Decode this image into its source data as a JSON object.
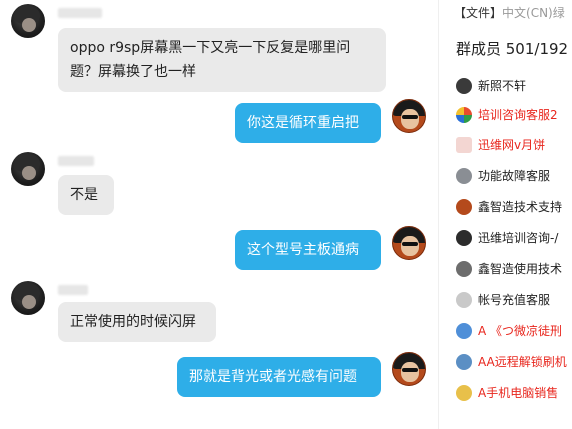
{
  "chat": {
    "messages": [
      {
        "side": "in",
        "text_line1": "oppo  r9sp屏幕黑一下又亮一下反复是哪里问",
        "text_line2": "题？屏幕换了也一样"
      },
      {
        "side": "out",
        "text": "你这是循环重启把"
      },
      {
        "side": "in",
        "text": "不是"
      },
      {
        "side": "out",
        "text": "这个型号主板通病"
      },
      {
        "side": "in",
        "text": "正常使用的时候闪屏"
      },
      {
        "side": "out",
        "text": "那就是背光或者光感有问题"
      }
    ]
  },
  "sidebar": {
    "file_tab": "【文件】",
    "file_sub": "中文(CN)绿",
    "members_title": "群成员 501/192",
    "members": [
      {
        "name": "新照不轩",
        "color": "#222222",
        "icon": "avatar-icon-dark"
      },
      {
        "name": "培训咨询客服2",
        "color": "#e8261d",
        "icon": "avatar-icon-colorful"
      },
      {
        "name": "迅维网v月饼",
        "color": "#e8261d",
        "icon": "avatar-icon-red"
      },
      {
        "name": "功能故障客服",
        "color": "#222222",
        "icon": "avatar-icon-gray"
      },
      {
        "name": "鑫智造技术支持",
        "color": "#222222",
        "icon": "avatar-icon-orange"
      },
      {
        "name": "迅维培训咨询-/",
        "color": "#222222",
        "icon": "avatar-icon-dark"
      },
      {
        "name": "鑫智造使用技术",
        "color": "#222222",
        "icon": "avatar-icon-gray"
      },
      {
        "name": "帐号充值客服",
        "color": "#222222",
        "icon": "avatar-icon-light"
      },
      {
        "name": "A 《つ微凉徒刑",
        "color": "#e8261d",
        "icon": "avatar-icon-blue"
      },
      {
        "name": "AA远程解锁刷机",
        "color": "#e8261d",
        "icon": "avatar-icon-blue"
      },
      {
        "name": "A手机电脑销售",
        "color": "#e8261d",
        "icon": "avatar-icon-yellow"
      }
    ]
  }
}
